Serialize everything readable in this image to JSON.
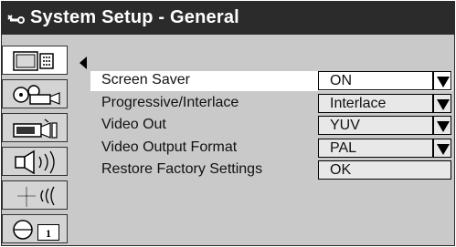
{
  "title": "System Setup - General",
  "sidebar": {
    "items": [
      {
        "icon": "tv-remote-icon",
        "active": true
      },
      {
        "icon": "projector-film-icon",
        "active": false
      },
      {
        "icon": "camera-film-icon",
        "active": false
      },
      {
        "icon": "speaker-sound-icon",
        "active": false
      },
      {
        "icon": "antenna-signal-icon",
        "active": false
      },
      {
        "icon": "page-indicator-icon",
        "page": "1",
        "active": false
      }
    ]
  },
  "settings": [
    {
      "label": "Screen Saver",
      "value": "ON",
      "dropdown": true
    },
    {
      "label": "Progressive/Interlace",
      "value": "Interlace",
      "dropdown": true
    },
    {
      "label": "Video Out",
      "value": "YUV",
      "dropdown": true
    },
    {
      "label": "Video Output Format",
      "value": "PAL",
      "dropdown": true
    },
    {
      "label": "Restore Factory Settings",
      "value": "OK",
      "dropdown": false
    }
  ],
  "colors": {
    "titlebar": "#2b2b2b",
    "panel": "#c9c9c9",
    "highlight": "#ffffff"
  }
}
